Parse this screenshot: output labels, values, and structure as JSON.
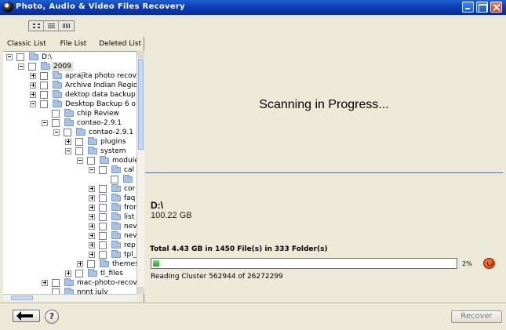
{
  "window": {
    "title": "Photo, Audio & Video Files Recovery"
  },
  "tabs": [
    "Classic List",
    "File List",
    "Deleted List"
  ],
  "tree": [
    {
      "label": "D:\\",
      "level": 0,
      "exp": "minus",
      "sel": false
    },
    {
      "label": "2009",
      "level": 1,
      "exp": "minus",
      "sel": true
    },
    {
      "label": "aprajita photo recove",
      "level": 2,
      "exp": "plus",
      "sel": false
    },
    {
      "label": "Archive Indian Regio",
      "level": 2,
      "exp": "plus",
      "sel": false
    },
    {
      "label": "dektop data backup",
      "level": 2,
      "exp": "plus",
      "sel": false
    },
    {
      "label": "Desktop Backup 6 o",
      "level": 2,
      "exp": "minus",
      "sel": false
    },
    {
      "label": "chip Review",
      "level": 3,
      "exp": "none",
      "sel": false
    },
    {
      "label": "contao-2.9.1",
      "level": 3,
      "exp": "minus",
      "sel": false
    },
    {
      "label": "contao-2.9.1",
      "level": 4,
      "exp": "minus",
      "sel": false
    },
    {
      "label": "plugins",
      "level": 5,
      "exp": "plus",
      "sel": false
    },
    {
      "label": "system",
      "level": 5,
      "exp": "minus",
      "sel": false
    },
    {
      "label": "module",
      "level": 6,
      "exp": "minus",
      "sel": false
    },
    {
      "label": "cal",
      "level": 7,
      "exp": "minus",
      "sel": false
    },
    {
      "label": "",
      "level": 8,
      "exp": "none",
      "sel": false
    },
    {
      "label": "cor",
      "level": 7,
      "exp": "plus",
      "sel": false
    },
    {
      "label": "faq",
      "level": 7,
      "exp": "plus",
      "sel": false
    },
    {
      "label": "fror",
      "level": 7,
      "exp": "plus",
      "sel": false
    },
    {
      "label": "list",
      "level": 7,
      "exp": "plus",
      "sel": false
    },
    {
      "label": "nev",
      "level": 7,
      "exp": "plus",
      "sel": false
    },
    {
      "label": "nev",
      "level": 7,
      "exp": "plus",
      "sel": false
    },
    {
      "label": "rep",
      "level": 7,
      "exp": "plus",
      "sel": false
    },
    {
      "label": "tpl_",
      "level": 7,
      "exp": "plus",
      "sel": false
    },
    {
      "label": "themes",
      "level": 6,
      "exp": "plus",
      "sel": false
    },
    {
      "label": "tl_files",
      "level": 5,
      "exp": "plus",
      "sel": false
    },
    {
      "label": "mac-photo-recove",
      "level": 3,
      "exp": "plus",
      "sel": false
    },
    {
      "label": "nnnt july",
      "level": 3,
      "exp": "none",
      "sel": false
    }
  ],
  "scan": {
    "title": "Scanning in Progress...",
    "drive": "D:\\",
    "size": "100.22 GB",
    "total": "Total 4.43 GB in 1450 File(s) in 333 Folder(s)",
    "progress_percent": 2,
    "percent_label": "2%",
    "reading": "Reading Cluster 562944  of  26272299"
  },
  "buttons": {
    "help": "?",
    "recover": "Recover"
  },
  "colors": {
    "titlebar": "#0a3cb5",
    "progress": "#22a31d",
    "panel": "#ece9d8"
  }
}
